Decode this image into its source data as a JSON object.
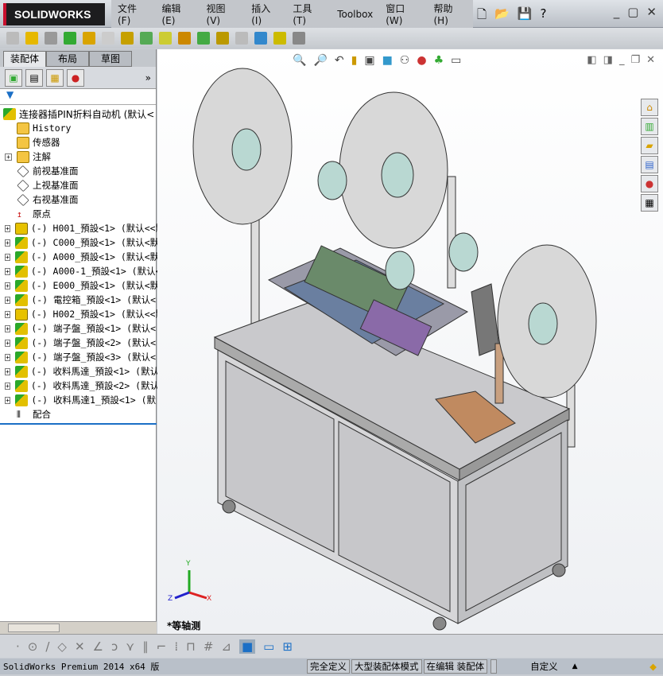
{
  "app": {
    "brand": "SOLIDWORKS"
  },
  "menu": [
    "文件(F)",
    "编辑(E)",
    "视图(V)",
    "插入(I)",
    "工具(T)",
    "Toolbox",
    "窗口(W)",
    "帮助(H)"
  ],
  "panel": {
    "tabs": [
      "装配体",
      "布局",
      "草图"
    ],
    "filter_icon": "funnel-icon",
    "tree": [
      {
        "label": "连接器插PIN折料自动机  (默认<",
        "icon": "assembly",
        "expand": false,
        "root": true
      },
      {
        "label": "History",
        "icon": "history-folder",
        "expand": false
      },
      {
        "label": "传感器",
        "icon": "sensor-folder",
        "expand": false
      },
      {
        "label": "注解",
        "icon": "annotation-folder",
        "expand": true
      },
      {
        "label": "前视基准面",
        "icon": "plane",
        "expand": false
      },
      {
        "label": "上视基准面",
        "icon": "plane",
        "expand": false
      },
      {
        "label": "右视基准面",
        "icon": "plane",
        "expand": false
      },
      {
        "label": "原点",
        "icon": "origin",
        "expand": false
      },
      {
        "label": "(-) H001_預設<1> (默认<<默",
        "icon": "part",
        "expand": true
      },
      {
        "label": "(-) C000_預設<1> (默认<默",
        "icon": "assembly",
        "expand": true
      },
      {
        "label": "(-) A000_預設<1> (默认<默",
        "icon": "assembly",
        "expand": true
      },
      {
        "label": "(-) A000-1_預設<1> (默认<",
        "icon": "assembly",
        "expand": true
      },
      {
        "label": "(-) E000_預設<1> (默认<默",
        "icon": "assembly",
        "expand": true
      },
      {
        "label": "(-) 電控箱_預設<1> (默认<",
        "icon": "assembly",
        "expand": true
      },
      {
        "label": "(-) H002_預設<1> (默认<<默",
        "icon": "part",
        "expand": true
      },
      {
        "label": "(-) 端子盤_預設<1> (默认<",
        "icon": "assembly",
        "expand": true
      },
      {
        "label": "(-) 端子盤_預設<2> (默认<",
        "icon": "assembly",
        "expand": true
      },
      {
        "label": "(-) 端子盤_預設<3> (默认<",
        "icon": "assembly",
        "expand": true
      },
      {
        "label": "(-) 收料馬達_預設<1> (默认",
        "icon": "assembly",
        "expand": true
      },
      {
        "label": "(-) 收料馬達_預設<2> (默认",
        "icon": "assembly",
        "expand": true
      },
      {
        "label": "(-) 收料馬達1_預設<1> (默",
        "icon": "assembly",
        "expand": true
      },
      {
        "label": "配合",
        "icon": "mates",
        "expand": false
      }
    ]
  },
  "viewport": {
    "view_name": "*等轴测",
    "triad": {
      "x": "X",
      "y": "Y",
      "z": "Z"
    }
  },
  "status": {
    "version": "SolidWorks Premium 2014 x64 版",
    "items": [
      "完全定义",
      "大型装配体模式",
      "在编辑 装配体"
    ],
    "units": "自定义",
    "units_arrow": "▲"
  },
  "colors": {
    "logo_bg": "#1d1d1f",
    "accent": "#c8102e",
    "table": "#c9c9cc",
    "reel": "#d8d8d8"
  }
}
